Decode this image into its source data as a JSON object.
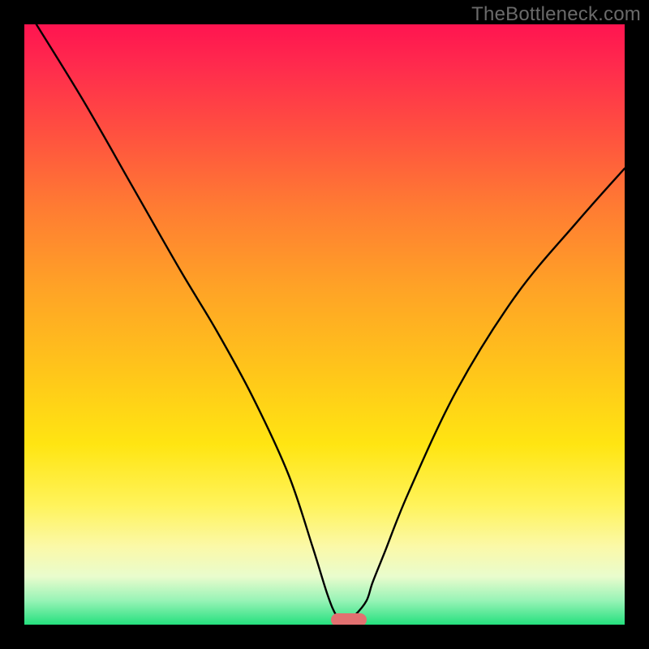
{
  "watermark": "TheBottleneck.com",
  "chart_data": {
    "type": "line",
    "title": "",
    "xlabel": "",
    "ylabel": "",
    "xlim": [
      0,
      100
    ],
    "ylim": [
      0,
      100
    ],
    "grid": false,
    "legend": false,
    "series": [
      {
        "name": "bottleneck-curve",
        "x": [
          2,
          10,
          18,
          26,
          32,
          38,
          44,
          48,
          50.5,
          52,
          53.5,
          55,
          57,
          58,
          60,
          64,
          72,
          82,
          92,
          100
        ],
        "values": [
          100,
          87,
          73,
          59,
          49,
          38,
          25,
          13,
          5,
          1.5,
          0.5,
          1.5,
          4,
          7,
          12,
          22,
          39,
          55,
          67,
          76
        ]
      }
    ],
    "annotations": [
      {
        "type": "marker",
        "x": 54,
        "y": 0.8,
        "shape": "rounded-bar",
        "color": "#e27070"
      }
    ],
    "background": {
      "type": "vertical-gradient",
      "stops": [
        {
          "pos": 0,
          "color": "#ff1450"
        },
        {
          "pos": 18,
          "color": "#ff5040"
        },
        {
          "pos": 44,
          "color": "#ffa326"
        },
        {
          "pos": 70,
          "color": "#ffe512"
        },
        {
          "pos": 87,
          "color": "#fbf9a8"
        },
        {
          "pos": 100,
          "color": "#25e07e"
        }
      ]
    }
  }
}
